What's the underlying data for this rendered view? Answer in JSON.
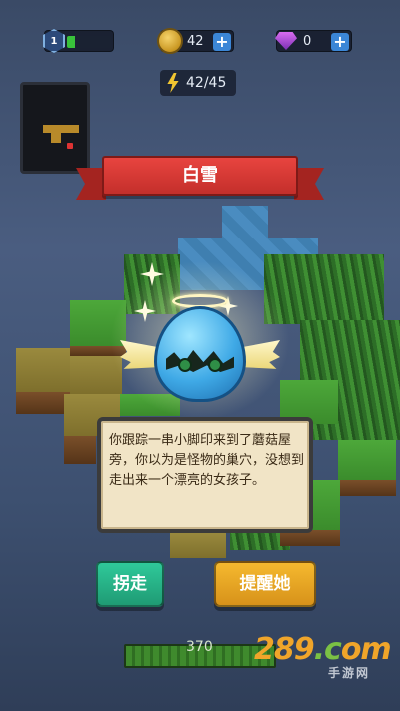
{
  "hud": {
    "level": "1",
    "xp_fill": 0.18,
    "coins": "42",
    "gems": "0",
    "plus_label": "+",
    "energy": "42/45"
  },
  "banner": {
    "title": "白雪"
  },
  "dialog": {
    "text": "你跟踪一串小脚印来到了蘑菇屋旁，你以为是怪物的巢穴，没想到走出来一个漂亮的女孩子。"
  },
  "buttons": {
    "kidnap_label": "拐走",
    "wake_label": "提醒她"
  },
  "steps": {
    "value": "370"
  },
  "watermark": {
    "logo_main": "289",
    "logo_dot": ".c",
    "logo_end": "om",
    "sub": "手游网"
  },
  "colors": {
    "banner": "#d63a36",
    "button_green": "#26b286",
    "button_orange": "#eba824",
    "dialog_bg": "#f1e4c6"
  }
}
